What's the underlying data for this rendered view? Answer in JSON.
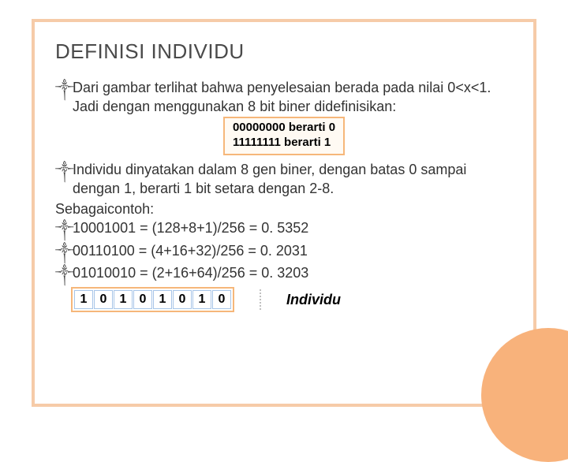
{
  "title": "DEFINISI INDIVIDU",
  "bullets": {
    "b1": "Dari gambar terlihat bahwa penyelesaian berada pada nilai 0<x<1. Jadi dengan menggunakan 8 bit biner didefinisikan:",
    "b2": "Individu dinyatakan dalam 8 gen biner, dengan batas 0 sampai dengan 1, berarti 1 bit setara dengan 2-8.",
    "contoh": "Sebagaicontoh:",
    "e1": "10001001 = (128+8+1)/256 = 0. 5352",
    "e2": "00110100 = (4+16+32)/256 = 0. 2031",
    "e3": "01010010 = (2+16+64)/256 = 0. 3203"
  },
  "binaryBox": {
    "line1": "00000000 berarti 0",
    "line2": "11111111 berarti 1"
  },
  "individu": {
    "cells": [
      "1",
      "0",
      "1",
      "0",
      "1",
      "0",
      "1",
      "0"
    ],
    "label": "Individu"
  },
  "bulletSymbol": "༒"
}
